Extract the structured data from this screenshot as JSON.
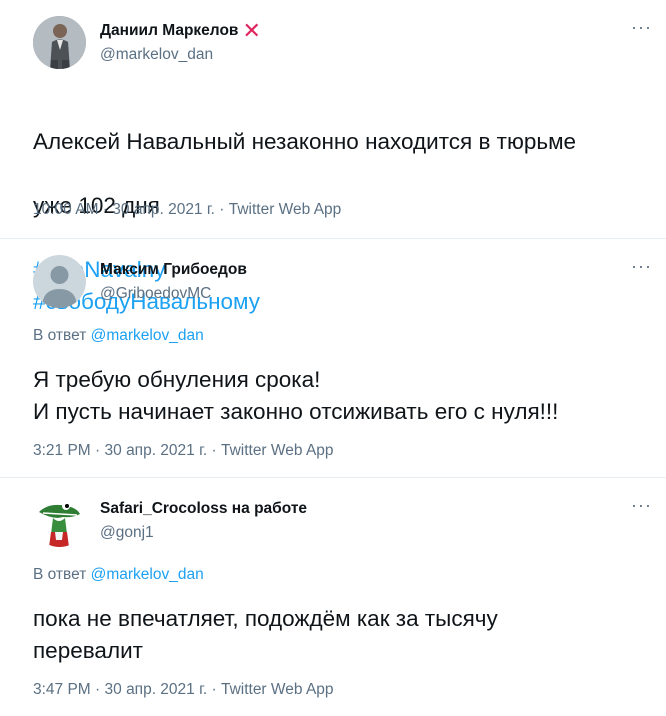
{
  "tweets": [
    {
      "author_name": "Даниил Маркелов",
      "author_mark": "✕",
      "handle": "@markelov_dan",
      "more": "···",
      "text_line1": "Алексей Навальный незаконно находится в тюрьме",
      "text_line2": "уже 102 дня",
      "hashtag1": "#freeNavalny",
      "hashtag2": "#свободуНавальному",
      "time": "10:00 AM",
      "date": "30 апр. 2021 г.",
      "app": "Twitter Web App",
      "separator": " · "
    },
    {
      "author_name": "Максим Грибоедов",
      "handle": "@GriboedovMC",
      "more": "···",
      "reply_prefix": "В ответ ",
      "reply_to": "@markelov_dan",
      "text": "Я требую обнуления срока!\nИ пусть начинает законно отсиживать его с нуля!!!",
      "time": "3:21 PM",
      "date": "30 апр. 2021 г.",
      "app": "Twitter Web App",
      "separator": " · "
    },
    {
      "author_name": "Safari_Crocoloss на работе",
      "handle": "@gonj1",
      "more": "···",
      "reply_prefix": "В ответ ",
      "reply_to": "@markelov_dan",
      "text": "пока не впечатляет, подождём как за тысячу\nперевалит",
      "time": "3:47 PM",
      "date": "30 апр. 2021 г.",
      "app": "Twitter Web App",
      "separator": " · "
    }
  ]
}
